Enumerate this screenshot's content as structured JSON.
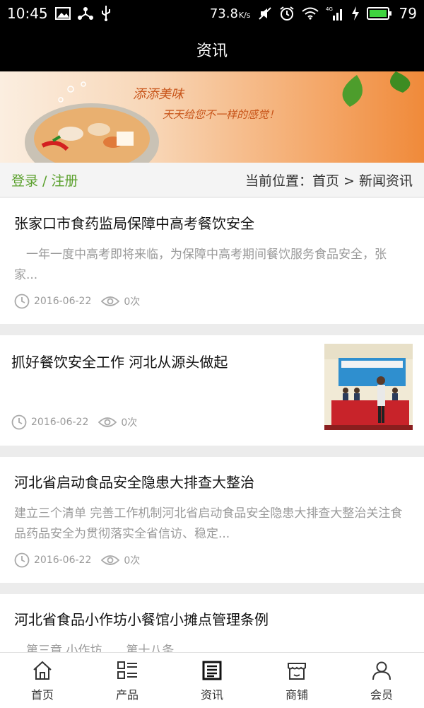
{
  "status_bar": {
    "time": "10:45",
    "speed": "73.8",
    "speed_unit": "K/s",
    "network": "4G",
    "battery": "79"
  },
  "header": {
    "title": "资讯"
  },
  "banner": {
    "line1": "添添美味",
    "line2": "天天给您不一样的感觉！"
  },
  "breadcrumb": {
    "login": "登录 / 注册",
    "location": "当前位置：首页 > 新闻资讯"
  },
  "news": [
    {
      "title": "张家口市食药监局保障中高考餐饮安全",
      "summary": "　一年一度中高考即将来临，为保障中高考期间餐饮服务食品安全，张家...",
      "date": "2016-06-22",
      "views": "0次"
    },
    {
      "title": "抓好餐饮安全工作 河北从源头做起",
      "summary": "",
      "date": "2016-06-22",
      "views": "0次"
    },
    {
      "title": "河北省启动食品安全隐患大排查大整治",
      "summary": "建立三个清单 完善工作机制河北省启动食品安全隐患大排查大整治关注食品药品安全为贯彻落实全省信访、稳定...",
      "date": "2016-06-22",
      "views": "0次"
    },
    {
      "title": "河北省食品小作坊小餐馆小摊点管理条例",
      "summary": "　第三章 小作坊　　第十八条",
      "date": "",
      "views": ""
    }
  ],
  "bottom_nav": [
    {
      "label": "首页",
      "icon": "home-icon"
    },
    {
      "label": "产品",
      "icon": "list-icon"
    },
    {
      "label": "资讯",
      "icon": "news-icon"
    },
    {
      "label": "商铺",
      "icon": "shop-icon"
    },
    {
      "label": "会员",
      "icon": "user-icon"
    }
  ],
  "colors": {
    "accent": "#5aa02c",
    "header_bg": "#000000",
    "meta": "#999999"
  }
}
